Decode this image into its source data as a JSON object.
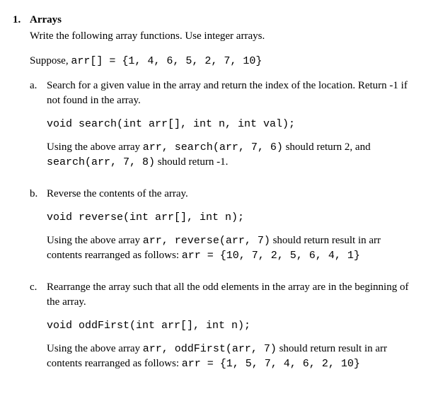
{
  "question": {
    "number": "1.",
    "title": "Arrays",
    "intro": "Write the following array functions.  Use integer arrays.",
    "suppose_prefix": "Suppose,  ",
    "suppose_code": "arr[] =  {1, 4, 6, 5, 2, 7, 10}"
  },
  "parts": {
    "a": {
      "label": "a.",
      "prompt": "Search for a given value in the array and return the index of the location. Return -1 if not found in the array.",
      "signature": "void search(int arr[], int n, int val);",
      "explain_1": "Using the above array ",
      "explain_code_1": "arr, search(arr, 7, 6)",
      "explain_2": " should return 2, and ",
      "explain_code_2": "search(arr, 7, 8)",
      "explain_3": " should return -1."
    },
    "b": {
      "label": "b.",
      "prompt": "Reverse the contents of the array.",
      "signature": "void reverse(int arr[], int n);",
      "explain_1": "Using the above array ",
      "explain_code_1": "arr, reverse(arr, 7)",
      "explain_2": " should return result in arr contents rearranged as follows:  ",
      "explain_code_2": "arr = {10, 7, 2, 5, 6, 4, 1}"
    },
    "c": {
      "label": "c.",
      "prompt": "Rearrange the array such that all the odd elements in the array are in the beginning of the array.",
      "signature": "void oddFirst(int arr[], int n);",
      "explain_1": "Using the above array ",
      "explain_code_1": "arr, oddFirst(arr, 7)",
      "explain_2": " should return result in arr contents rearranged as follows:  ",
      "explain_code_2": "arr = {1, 5, 7, 4, 6, 2, 10}"
    }
  }
}
